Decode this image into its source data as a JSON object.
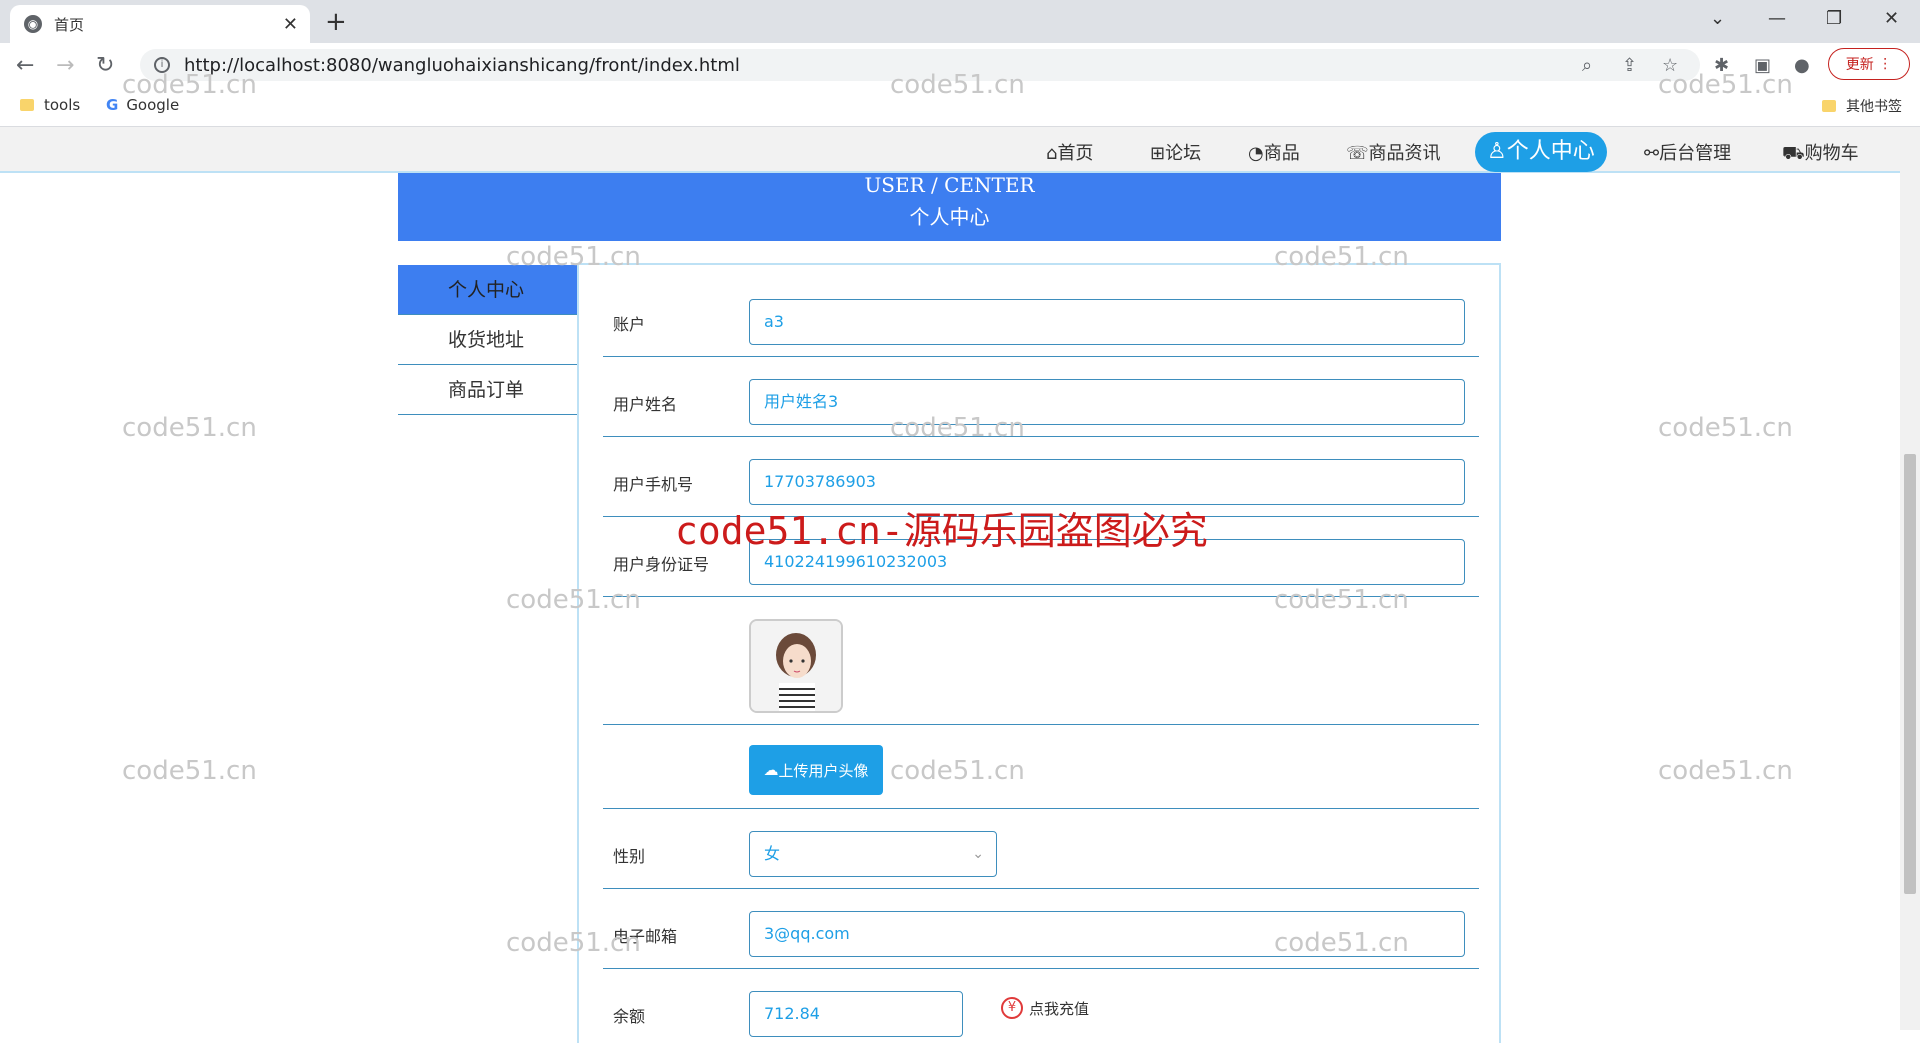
{
  "browser": {
    "tab_title": "首页",
    "url": "http://localhost:8080/wangluohaixianshicang/front/index.html",
    "update_label": "更新",
    "bookmarks": [
      "tools",
      "Google"
    ],
    "other_bookmarks": "其他书签"
  },
  "nav": {
    "items": [
      "首页",
      "论坛",
      "商品",
      "商品资讯",
      "个人中心",
      "后台管理",
      "购物车"
    ],
    "active": "个人中心"
  },
  "banner": {
    "en": "USER / CENTER",
    "cn": "个人中心"
  },
  "sidemenu": [
    "个人中心",
    "收货地址",
    "商品订单"
  ],
  "form": {
    "account_label": "账户",
    "account_value": "a3",
    "name_label": "用户姓名",
    "name_value": "用户姓名3",
    "phone_label": "用户手机号",
    "phone_value": "17703786903",
    "idcard_label": "用户身份证号",
    "idcard_value": "410224199610232003",
    "upload_label": "上传用户头像",
    "gender_label": "性别",
    "gender_value": "女",
    "email_label": "电子邮箱",
    "email_value": "3@qq.com",
    "balance_label": "余额",
    "balance_value": "712.84",
    "recharge_label": "点我充值"
  },
  "watermarks": {
    "small": "code51.cn",
    "red": "code51.cn-源码乐园盗图必究"
  }
}
